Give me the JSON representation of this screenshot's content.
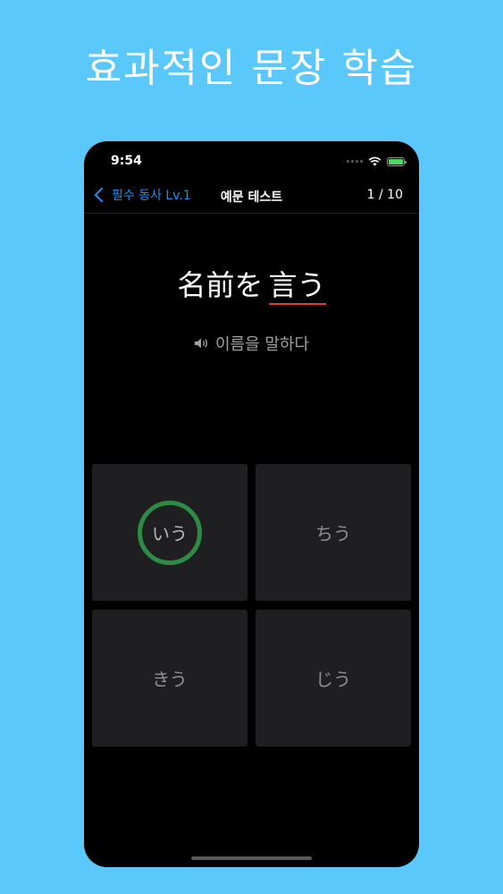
{
  "promo": {
    "title": "효과적인 문장 학습"
  },
  "status": {
    "time": "9:54"
  },
  "nav": {
    "back_label": "필수 동사 Lv.1",
    "title": "예문 테스트",
    "counter": "1 / 10"
  },
  "question": {
    "prefix": "名前を",
    "target": "言う",
    "translation": "이름을 말하다"
  },
  "choices": [
    {
      "label": "いう",
      "state": "correct"
    },
    {
      "label": "ちう",
      "state": "none"
    },
    {
      "label": "きう",
      "state": "none"
    },
    {
      "label": "じう",
      "state": "none"
    }
  ],
  "colors": {
    "background": "#5ac8fa",
    "accent": "#1e8ff5",
    "correct_ring": "#2e8b45",
    "underline": "#e0383e"
  }
}
